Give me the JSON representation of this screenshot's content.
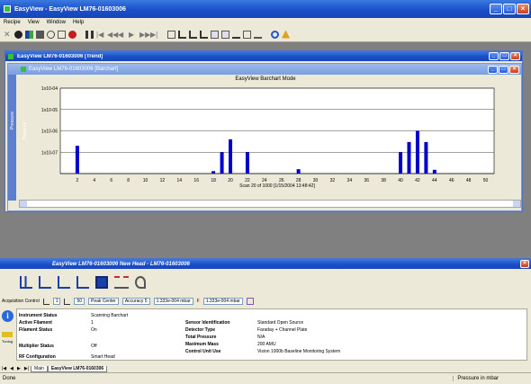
{
  "app": {
    "title": "EasyView - EasyView LM76-01603006",
    "menu": [
      "Recipe",
      "View",
      "Window",
      "Help"
    ]
  },
  "trend_window": {
    "title": "EasyView LM76-01603006 [Trend]"
  },
  "barchart_window": {
    "title": "EasyView LM76-01603006 [Barchart]",
    "side_label": "Pressure"
  },
  "chart_data": {
    "type": "bar",
    "title": "EasyView Barchart Mode",
    "ylabel": "Pressure",
    "xlabel": "Scan 20 of 1000 [1/15/2004 13:48:42]",
    "x_ticks": [
      2,
      4,
      6,
      8,
      10,
      12,
      14,
      16,
      18,
      20,
      22,
      24,
      26,
      28,
      30,
      32,
      34,
      36,
      38,
      40,
      42,
      44,
      46,
      48,
      50
    ],
    "y_ticks": [
      "1x10-04",
      "1x10-05",
      "1x10-06",
      "1x10-07"
    ],
    "log_y": true,
    "ylim": [
      1e-08,
      0.0001
    ],
    "x": [
      2,
      18,
      19,
      20,
      22,
      28,
      40,
      41,
      42,
      43,
      44
    ],
    "values": [
      2e-07,
      1.3e-08,
      1e-07,
      4e-07,
      1e-07,
      1.6e-08,
      1e-07,
      3e-07,
      1e-06,
      3e-07,
      1.5e-08
    ],
    "color": "#0000cc",
    "grid": true
  },
  "lower_window": {
    "title": "EasyView LM76-01603006 New Head - LM76-01603006",
    "acq_label": "Acquisition Control",
    "ctrl1": "1",
    "ctrl2": "50",
    "peak_mode": "Peak Center",
    "accuracy": "Accuracy 5",
    "pressure1": "1.333e-004 mbar",
    "pressure2": "1.333e-004 mbar",
    "side_label": "Tuning",
    "left_info": [
      {
        "label": "Instrument Status",
        "value": "Scanning Barchart"
      },
      {
        "label": "Active Filament",
        "value": "1"
      },
      {
        "label": "Filament Status",
        "value": "On"
      },
      {
        "label": "Multiplier Status",
        "value": "Off"
      },
      {
        "label": "RF Configuration",
        "value": "Smart Head"
      }
    ],
    "right_info": [
      {
        "label": "Sensor Identification",
        "value": "Standard Open Source"
      },
      {
        "label": "Detector Type",
        "value": "Faraday + Channel Plate"
      },
      {
        "label": "Total Pressure",
        "value": "N/A"
      },
      {
        "label": "Maximum Mass",
        "value": "200 AMU"
      },
      {
        "label": "Control Unit Use",
        "value": "Vision 1000b Baseline Monitoring System"
      }
    ],
    "tabs": [
      "Main",
      "EasyView LM76-0160306"
    ]
  },
  "status": {
    "left": "Done",
    "right": "Pressure in mbar"
  }
}
